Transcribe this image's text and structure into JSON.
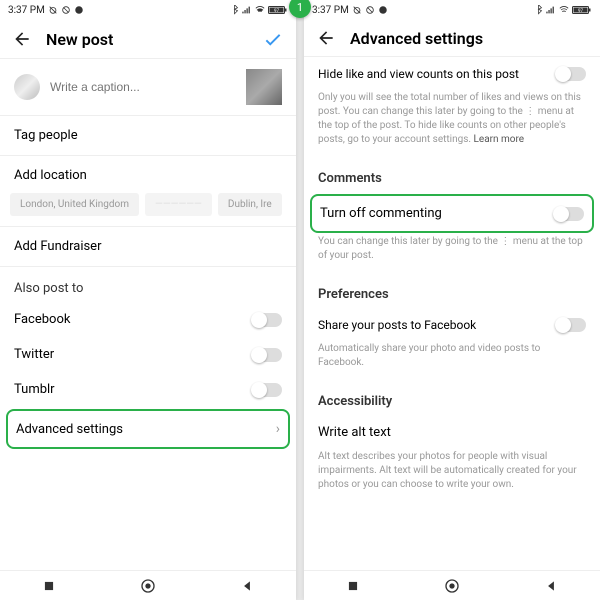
{
  "status": {
    "time": "3:37 PM",
    "battery": "97"
  },
  "badge": "1",
  "left": {
    "title": "New post",
    "caption_placeholder": "Write a caption...",
    "tag_people": "Tag people",
    "add_location": "Add location",
    "loc1": "London, United Kingdom",
    "loc2": "——————",
    "loc3": "Dublin, Ire",
    "add_fundraiser": "Add Fundraiser",
    "also_post": "Also post to",
    "facebook": "Facebook",
    "twitter": "Twitter",
    "tumblr": "Tumblr",
    "advanced": "Advanced settings"
  },
  "right": {
    "title": "Advanced settings",
    "hide_counts": "Hide like and view counts on this post",
    "hide_desc_1": "Only you will see the total number of likes and views on this post. You can change this later by going to the ⋮ menu at the top of the post. To hide like counts on other people's posts, go to your account settings. ",
    "learn_more": "Learn more",
    "comments_heading": "Comments",
    "turn_off": "Turn off commenting",
    "turn_off_desc": "You can change this later by going to the ⋮ menu at the top of your post.",
    "preferences_heading": "Preferences",
    "share_fb": "Share your posts to Facebook",
    "share_fb_desc": "Automatically share your photo and video posts to Facebook.",
    "accessibility_heading": "Accessibility",
    "alt_text": "Write alt text",
    "alt_desc": "Alt text describes your photos for people with visual impairments. Alt text will be automatically created for your photos or you can choose to write your own."
  }
}
